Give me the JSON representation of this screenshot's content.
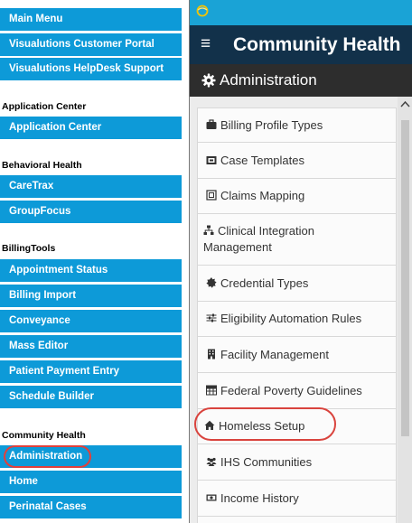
{
  "left_nav": {
    "top_items": [
      "Main Menu",
      "Visualutions Customer Portal",
      "Visualutions HelpDesk Support"
    ],
    "sections": [
      {
        "title": "Application Center",
        "items": [
          "Application Center"
        ]
      },
      {
        "title": "Behavioral Health",
        "items": [
          "CareTrax",
          "GroupFocus"
        ]
      },
      {
        "title": "BillingTools",
        "items": [
          "Appointment Status",
          "Billing Import",
          "Conveyance",
          "Mass Editor",
          "Patient Payment Entry",
          "Schedule Builder"
        ]
      },
      {
        "title": "Community Health",
        "items": [
          "Administration",
          "Home",
          "Perinatal Cases"
        ]
      }
    ],
    "highlighted_item": "Administration"
  },
  "app": {
    "title": "Community Health",
    "section": "Administration",
    "menu_items": [
      {
        "label": "Billing Profile Types",
        "icon": "briefcase-icon"
      },
      {
        "label": "Case Templates",
        "icon": "copy-icon"
      },
      {
        "label": "Claims Mapping",
        "icon": "map-icon"
      },
      {
        "label_lines": [
          "Clinical Integration",
          "Management"
        ],
        "icon": "sitemap-icon"
      },
      {
        "label": "Credential Types",
        "icon": "certificate-icon"
      },
      {
        "label": "Eligibility Automation Rules",
        "icon": "sliders-icon"
      },
      {
        "label": "Facility Management",
        "icon": "building-icon"
      },
      {
        "label": "Federal Poverty Guidelines",
        "icon": "table-icon"
      },
      {
        "label": "Homeless Setup",
        "icon": "home-icon"
      },
      {
        "label": "IHS Communities",
        "icon": "users-icon"
      },
      {
        "label": "Income History",
        "icon": "money-icon"
      }
    ],
    "highlighted_item": "Homeless Setup"
  },
  "colors": {
    "nav_blue": "#0d9ad8",
    "header_navy": "#12314a",
    "section_bar": "#2d2d2d",
    "highlight_red": "#e2403b"
  }
}
